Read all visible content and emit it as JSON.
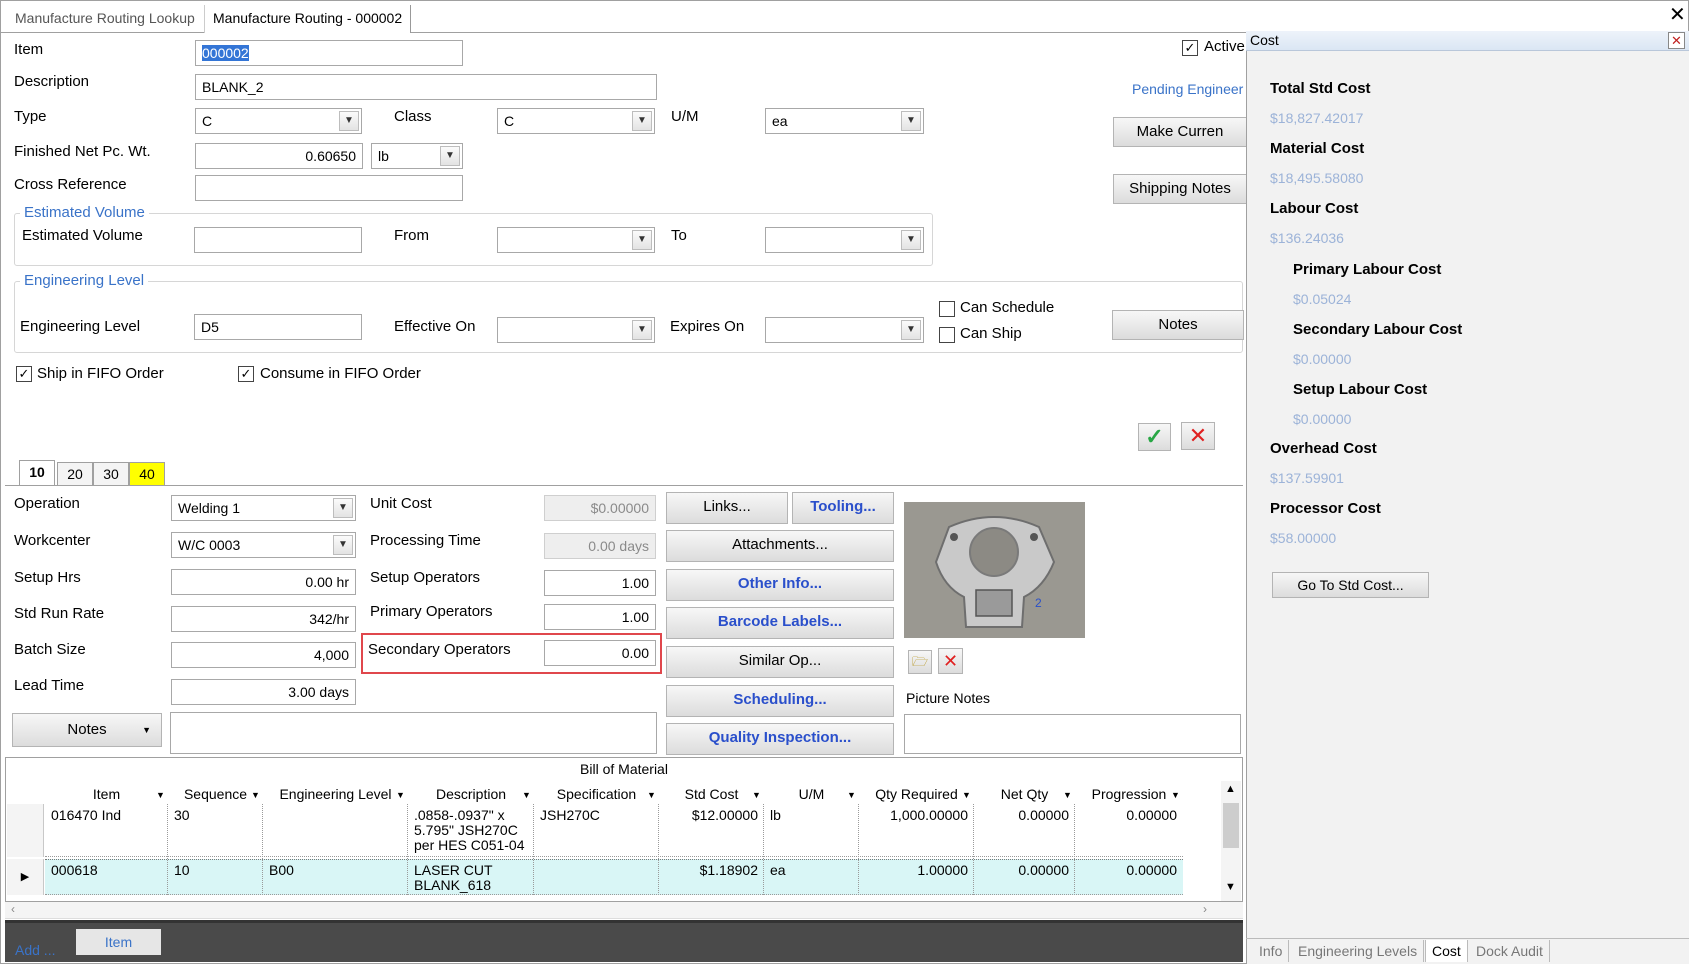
{
  "tabs": {
    "lookup": "Manufacture Routing Lookup",
    "current": "Manufacture Routing - 000002"
  },
  "header": {
    "item_label": "Item",
    "item_value": "000002",
    "description_label": "Description",
    "description_value": "BLANK_2",
    "type_label": "Type",
    "type_value": "C",
    "class_label": "Class",
    "class_value": "C",
    "um_label": "U/M",
    "um_value": "ea",
    "netwt_label": "Finished Net Pc. Wt.",
    "netwt_value": "0.60650",
    "netwt_unit": "lb",
    "crossref_label": "Cross Reference",
    "crossref_value": "",
    "active_label": "Active",
    "pending_link": "Pending Engineer",
    "make_current": "Make Curren",
    "shipping_notes": "Shipping Notes"
  },
  "estimated_volume": {
    "group_title": "Estimated Volume",
    "label": "Estimated Volume",
    "value": "",
    "from_label": "From",
    "to_label": "To"
  },
  "engineering": {
    "group_title": "Engineering Level",
    "label": "Engineering Level",
    "value": "D5",
    "effective_label": "Effective On",
    "expires_label": "Expires On",
    "can_schedule": "Can Schedule",
    "can_ship": "Can Ship",
    "notes_button": "Notes"
  },
  "fifo": {
    "ship": "Ship in FIFO Order",
    "consume": "Consume in FIFO Order"
  },
  "op_tabs": [
    "10",
    "20",
    "30",
    "40"
  ],
  "operation": {
    "operation_label": "Operation",
    "operation_value": "Welding 1",
    "workcenter_label": "Workcenter",
    "workcenter_value": "W/C 0003",
    "setup_label": "Setup Hrs",
    "setup_value": "0.00 hr",
    "runrate_label": "Std Run Rate",
    "runrate_value": "342/hr",
    "batch_label": "Batch Size",
    "batch_value": "4,000",
    "lead_label": "Lead Time",
    "lead_value": "3.00 days",
    "notes_button": "Notes",
    "unitcost_label": "Unit Cost",
    "unitcost_value": "$0.00000",
    "proctime_label": "Processing Time",
    "proctime_value": "0.00 days",
    "setupops_label": "Setup Operators",
    "setupops_value": "1.00",
    "primops_label": "Primary Operators",
    "primops_value": "1.00",
    "secops_label": "Secondary Operators",
    "secops_value": "0.00"
  },
  "op_buttons": {
    "links": "Links...",
    "tooling": "Tooling...",
    "attachments": "Attachments...",
    "other": "Other Info...",
    "barcode": "Barcode Labels...",
    "similar": "Similar Op...",
    "scheduling": "Scheduling...",
    "quality": "Quality Inspection..."
  },
  "picture": {
    "notes_label": "Picture Notes"
  },
  "bom": {
    "title": "Bill of Material",
    "columns": [
      "Item",
      "Sequence",
      "Engineering Level",
      "Description",
      "Specification",
      "Std Cost",
      "U/M",
      "Qty Required",
      "Net Qty",
      "Progression"
    ],
    "rows": [
      [
        "016470 Ind",
        "30",
        "",
        ".0858-.0937\" x\n5.795\" JSH270C\nper HES C051-04",
        "JSH270C",
        "$12.00000",
        "lb",
        "1,000.00000",
        "0.00000",
        "0.00000"
      ],
      [
        "000618",
        "10",
        "B00",
        "LASER CUT\nBLANK_618",
        "",
        "$1.18902",
        "ea",
        "1.00000",
        "0.00000",
        "0.00000"
      ]
    ],
    "add_label": "Add ...",
    "item_tab": "Item"
  },
  "cost_panel": {
    "title": "Cost",
    "total_label": "Total Std Cost",
    "total_value": "$18,827.42017",
    "material_label": "Material Cost",
    "material_value": "$18,495.58080",
    "labour_label": "Labour Cost",
    "labour_value": "$136.24036",
    "primary_label": "Primary Labour Cost",
    "primary_value": "$0.05024",
    "secondary_label": "Secondary Labour Cost",
    "secondary_value": "$0.00000",
    "setup_label": "Setup Labour Cost",
    "setup_value": "$0.00000",
    "overhead_label": "Overhead Cost",
    "overhead_value": "$137.59901",
    "processor_label": "Processor Cost",
    "processor_value": "$58.00000",
    "goto_button": "Go To Std Cost..."
  },
  "bottom_tabs": [
    "Info",
    "Engineering Levels",
    "Cost",
    "Dock Audit"
  ],
  "colors": {
    "accent": "#3a73c8",
    "highlight_box": "#e0474c",
    "row_selected": "#d9f6f6",
    "tab_yellow": "#ffff00"
  }
}
